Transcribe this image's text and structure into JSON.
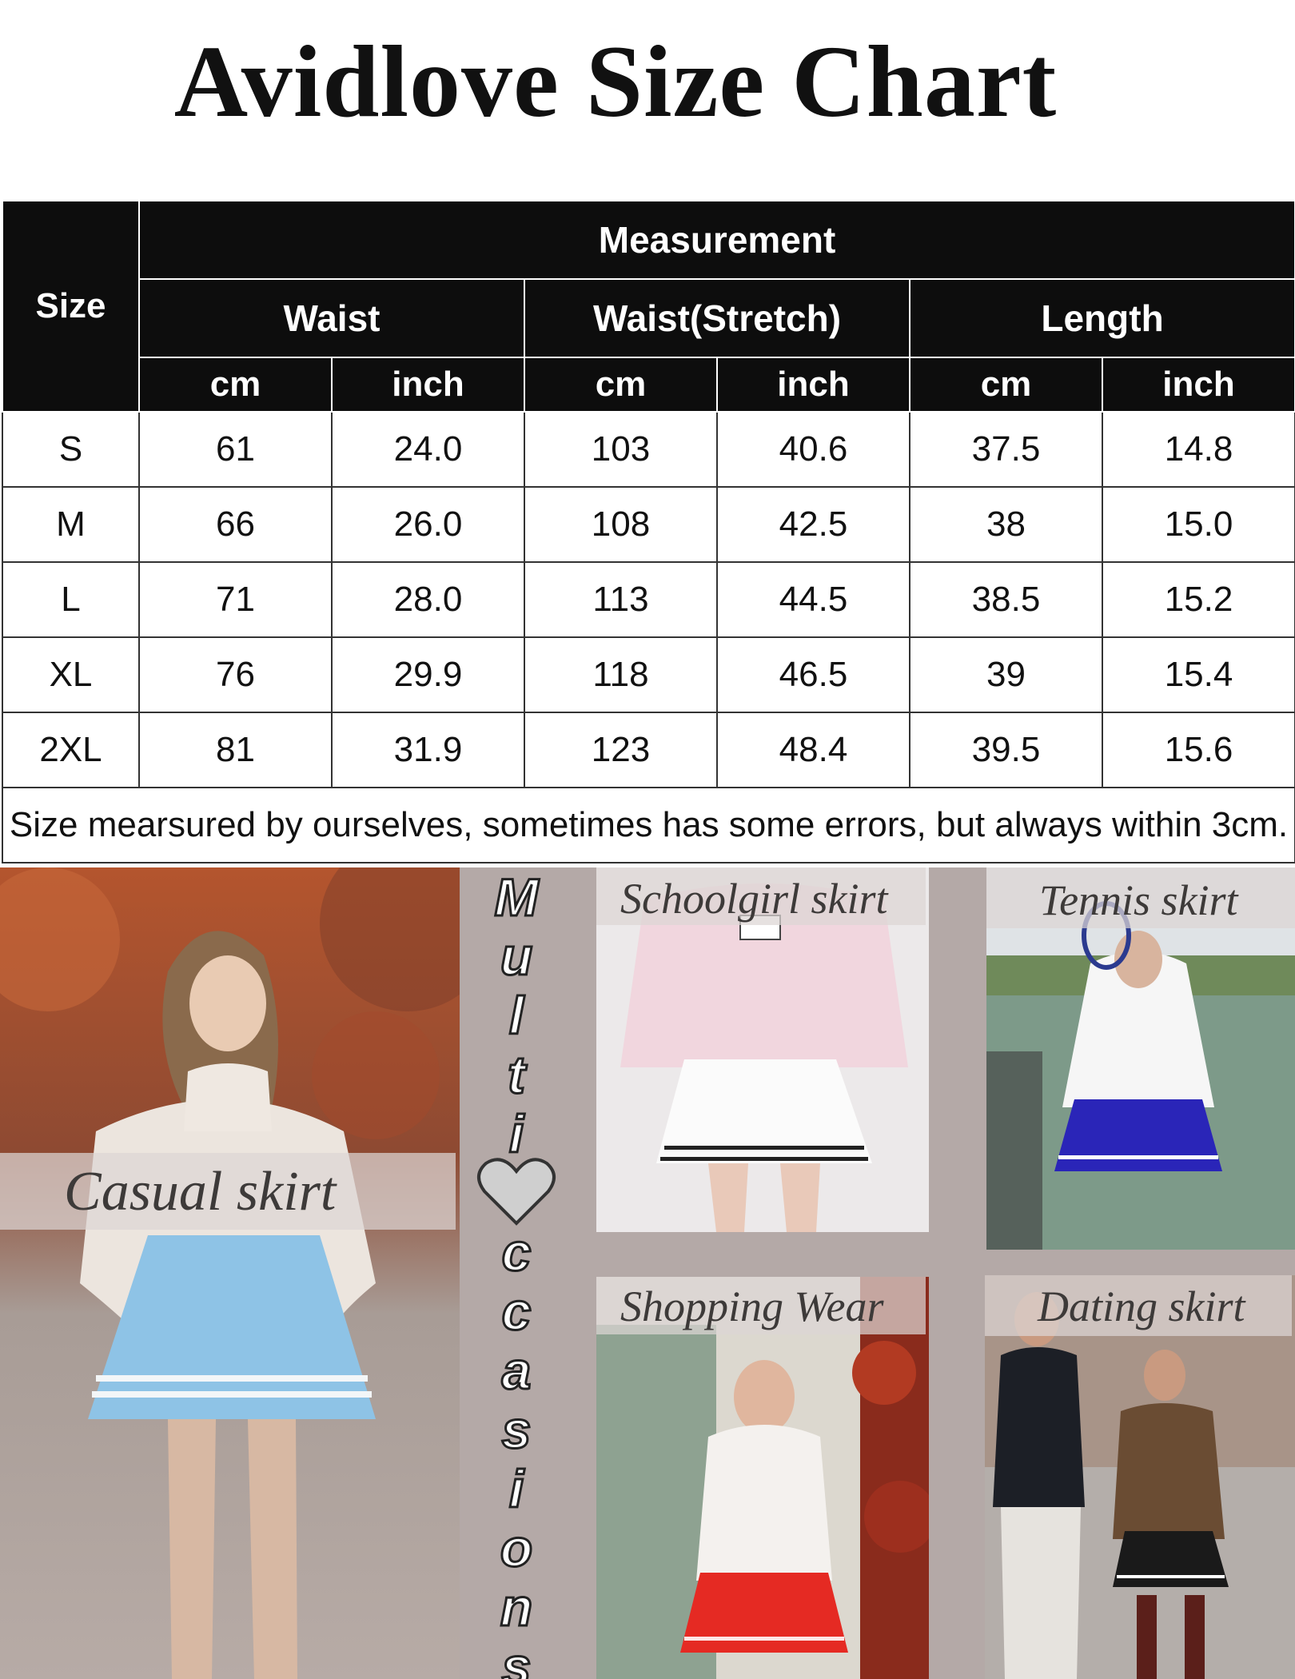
{
  "title": "Avidlove Size Chart",
  "table": {
    "size_header": "Size",
    "measurement_header": "Measurement",
    "groups": [
      "Waist",
      "Waist(Stretch)",
      "Length"
    ],
    "units": [
      "cm",
      "inch",
      "cm",
      "inch",
      "cm",
      "inch"
    ],
    "rows": [
      [
        "S",
        "61",
        "24.0",
        "103",
        "40.6",
        "37.5",
        "14.8"
      ],
      [
        "M",
        "66",
        "26.0",
        "108",
        "42.5",
        "38",
        "15.0"
      ],
      [
        "L",
        "71",
        "28.0",
        "113",
        "44.5",
        "38.5",
        "15.2"
      ],
      [
        "XL",
        "76",
        "29.9",
        "118",
        "46.5",
        "39",
        "15.4"
      ],
      [
        "2XL",
        "81",
        "31.9",
        "123",
        "48.4",
        "39.5",
        "15.6"
      ]
    ],
    "note": "Size mearsured by ourselves, sometimes has some errors, but always within 3cm."
  },
  "occasions": {
    "vertical_text": "Multioccasions",
    "casual": "Casual skirt",
    "schoolgirl": "Schoolgirl skirt",
    "tennis": "Tennis skirt",
    "shopping": "Shopping Wear",
    "dating": "Dating skirt"
  },
  "colors": {
    "header_bg": "#0d0d0d",
    "photo_bg": "#b4a9a7",
    "skirt_blue": "#8ec3e6",
    "skirt_navy": "#2a25b8",
    "skirt_red": "#e52a23",
    "skirt_black": "#1a1a1a"
  }
}
